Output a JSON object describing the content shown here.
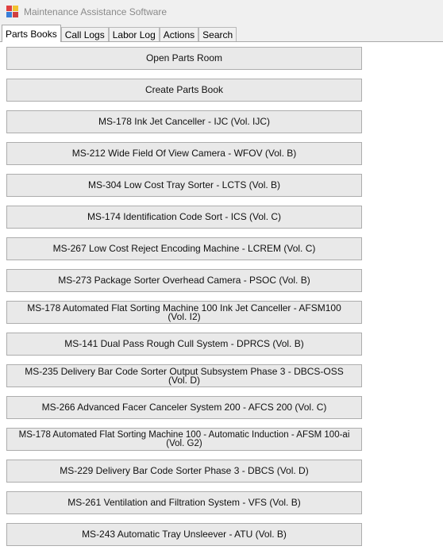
{
  "window": {
    "title": "Maintenance Assistance Software",
    "icon": "app-icon"
  },
  "tabs": [
    {
      "label": "Parts Books",
      "active": true
    },
    {
      "label": "Call Logs",
      "active": false
    },
    {
      "label": "Labor Log",
      "active": false
    },
    {
      "label": "Actions",
      "active": false
    },
    {
      "label": "Search",
      "active": false
    }
  ],
  "buttons": [
    "Open Parts Room",
    "Create Parts Book",
    "MS-178 Ink Jet Canceller - IJC (Vol. IJC)",
    "MS-212 Wide Field Of View Camera - WFOV (Vol. B)",
    "MS-304 Low Cost Tray Sorter - LCTS (Vol. B)",
    "MS-174 Identification Code Sort - ICS (Vol. C)",
    "MS-267 Low Cost Reject Encoding Machine - LCREM (Vol. C)",
    "MS-273 Package Sorter Overhead Camera - PSOC (Vol. B)",
    "MS-178 Automated Flat Sorting Machine 100 Ink Jet Canceller - AFSM100 (Vol. I2)",
    "MS-141 Dual Pass Rough Cull System - DPRCS (Vol. B)",
    "MS-235 Delivery Bar Code Sorter Output Subsystem Phase 3 - DBCS-OSS (Vol. D)",
    "MS-266 Advanced Facer Canceler System 200 - AFCS 200 (Vol. C)",
    "MS-178 Automated Flat Sorting Machine 100 - Automatic Induction - AFSM 100-ai (Vol. G2)",
    "MS-229 Delivery Bar Code Sorter Phase 3 - DBCS (Vol. D)",
    "MS-261 Ventilation and Filtration System - VFS (Vol. B)",
    "MS-243 Automatic Tray Unsleever - ATU (Vol. B)"
  ]
}
